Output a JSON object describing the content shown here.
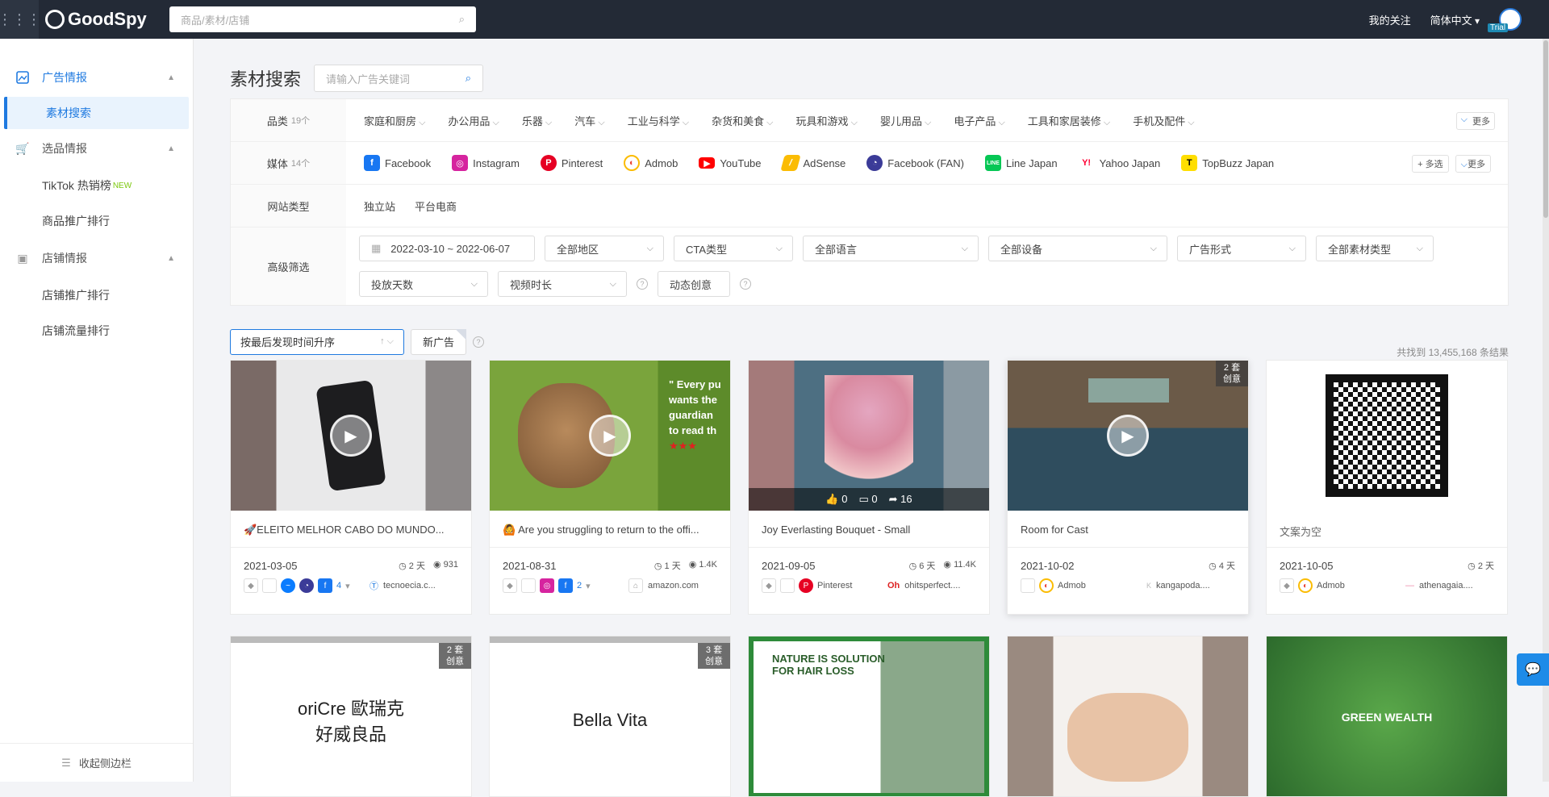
{
  "topbar": {
    "brand": "GoodSpy",
    "search_placeholder": "商品/素材/店铺",
    "follow": "我的关注",
    "lang": "简体中文",
    "trial": "Trial"
  },
  "sidebar": {
    "groups": [
      {
        "label": "广告情报",
        "items": [
          "素材搜索"
        ]
      },
      {
        "label": "选品情报",
        "items": [
          "TikTok 热销榜",
          "商品推广排行"
        ],
        "new_badge": "NEW"
      },
      {
        "label": "店铺情报",
        "items": [
          "店铺推广排行",
          "店铺流量排行"
        ]
      }
    ],
    "collapse": "收起侧边栏"
  },
  "page": {
    "title": "素材搜索",
    "keyword_placeholder": "请输入广告关键词"
  },
  "filters": {
    "category": {
      "label": "品类",
      "count": "19个",
      "options": [
        "家庭和厨房",
        "办公用品",
        "乐器",
        "汽车",
        "工业与科学",
        "杂货和美食",
        "玩具和游戏",
        "婴儿用品",
        "电子产品",
        "工具和家居装修",
        "手机及配件"
      ],
      "more": "更多"
    },
    "media": {
      "label": "媒体",
      "count": "14个",
      "options": [
        "Facebook",
        "Instagram",
        "Pinterest",
        "Admob",
        "YouTube",
        "AdSense",
        "Facebook (FAN)",
        "Line Japan",
        "Yahoo Japan",
        "TopBuzz Japan"
      ],
      "multi": "多选",
      "more": "更多"
    },
    "site": {
      "label": "网站类型",
      "options": [
        "独立站",
        "平台电商"
      ]
    },
    "advanced": {
      "label": "高级筛选",
      "date": "2022-03-10 ~ 2022-06-07",
      "selects": [
        "全部地区",
        "CTA类型",
        "全部语言",
        "全部设备",
        "广告形式",
        "全部素材类型",
        "投放天数",
        "视频时长"
      ],
      "dynamic": "动态创意"
    }
  },
  "sort": {
    "value": "按最后发现时间升序",
    "new_ad": "新广告",
    "total": "共找到 13,455,168 条结果"
  },
  "cards": [
    {
      "title": "🚀ELEITO MELHOR CABO DO MUNDO...",
      "date": "2021-03-05",
      "days": "2 天",
      "views": "931",
      "extra": "4",
      "site": "tecnoecia.c..."
    },
    {
      "title": "🙆 Are you struggling to return to the offi...",
      "date": "2021-08-31",
      "days": "1 天",
      "views": "1.4K",
      "extra": "2",
      "site": "amazon.com"
    },
    {
      "title": "Joy Everlasting Bouquet - Small",
      "date": "2021-09-05",
      "days": "6 天",
      "views": "11.4K",
      "platform": "Pinterest",
      "site": "ohitsperfect....",
      "likes": "0",
      "comments": "0",
      "shares": "16"
    },
    {
      "title": "Room for Cast",
      "date": "2021-10-02",
      "days": "4 天",
      "platform": "Admob",
      "site": "kangapoda....",
      "badge": "2 套 创意"
    },
    {
      "title": "文案为空",
      "date": "2021-10-05",
      "days": "2 天",
      "platform": "Admob",
      "site": "athenagaia...."
    }
  ],
  "row2": [
    {
      "text": "oriCre 歐瑞克好威良品",
      "badge": "2 套 创意"
    },
    {
      "text": "Bella Vita",
      "badge": "3 套 创意"
    },
    {
      "text": "NATURE IS SOLUTION FOR HAIR LOSS"
    },
    {
      "text": ""
    },
    {
      "text": "GREEN WEALTH"
    }
  ]
}
